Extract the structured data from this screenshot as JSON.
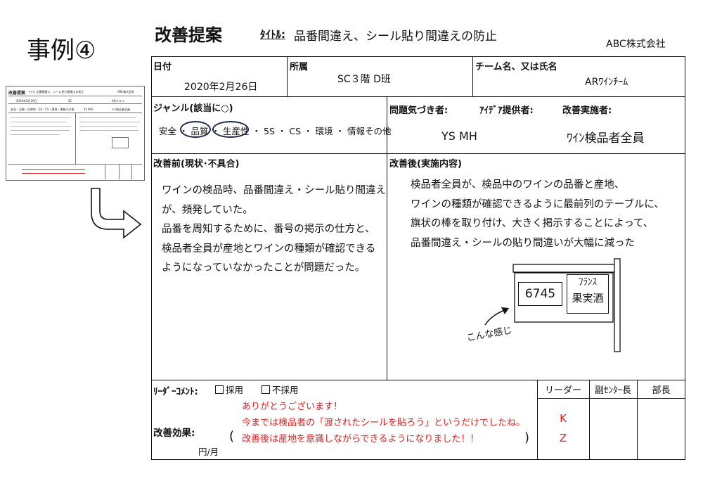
{
  "case_label": "事例④",
  "doc": {
    "title": "改善提案",
    "subtitle_label": "ﾀｲﾄﾙ:",
    "subtitle_value": "品番間違え、シール貼り間違えの防止",
    "company": "ABC株式会社"
  },
  "row1": {
    "date_label": "日付",
    "date_value": "2020年2月26日",
    "dept_label": "所属",
    "dept_value": "SC３階 D班",
    "team_label": "チーム名、又は氏名",
    "team_value": "ARﾜｲﾝﾁｰﾑ"
  },
  "genre": {
    "label": "ジャンル(該当に○)",
    "items": [
      "安全",
      "品質",
      "生産性",
      "5S",
      "CS",
      "環境",
      "情報その他"
    ],
    "separator": "・"
  },
  "people": {
    "noticer_label": "問題気づき者:",
    "idea_label": "ｱｲﾃﾞｱ提供者:",
    "implementer_label": "改善実施者:",
    "noticer_idea_value": "YS MH",
    "implementer_value": "ﾜｲﾝ検品者全員"
  },
  "before": {
    "label": "改善前(現状･不具合)",
    "lines": [
      "ワインの検品時、品番間違え・シール貼り間違え",
      "が、頻発していた。",
      "品番を周知するために、番号の掲示の仕方と、",
      "検品者全員が産地とワインの種類が確認できる",
      "ようになっていなかったことが問題だった。"
    ]
  },
  "after": {
    "label": "改善後(実施内容)",
    "lines": [
      "検品者全員が、検品中のワインの品番と産地、",
      "ワインの種類が確認できるように最前列のテーブルに、",
      "旗状の棒を取り付け、大きく掲示することによって、",
      "品番間違え・シールの貼り間違いが大幅に減った"
    ],
    "sign_number": "6745",
    "sign_line1": "ﾌﾗﾝｽ",
    "sign_line2": "果実酒",
    "sketch_note": "こんな感じ"
  },
  "bottom": {
    "leader_comment_label": "ﾘｰﾀﾞｰｺﾒﾝﾄ:",
    "adopt_label": "採用",
    "reject_label": "不採用",
    "effect_label": "改善効果:",
    "per_month": "円/月",
    "paren_open": "(",
    "paren_close": ")",
    "comment_lines": [
      "ありがとうございます！",
      "今までは検品者の「渡されたシールを貼ろう」というだけでしたね。",
      "改善後は産地を意識しながらできるようになりました！！"
    ],
    "approvers": [
      "リーダー",
      "副ｾﾝﾀｰ長",
      "部長"
    ],
    "leader_stamp_1": "K",
    "leader_stamp_2": "Z"
  },
  "thumbnail": {
    "title": "改善提案",
    "subtitle": "ﾀｲﾄﾙ: 品番間違え、シール貼り間違えの防止",
    "company": "ABC株式会社",
    "date": "2020年2月26日",
    "dept": "SC",
    "team": "ARﾜｲﾝﾁｰﾑ",
    "genre": "安全・品質・生産性・5S・CS・環境・情報その他",
    "people": "YS MH",
    "implementer": "ﾜｲﾝ検品者全員"
  },
  "colors": {
    "accent_red": "#e02020",
    "circle_navy": "#1b2a4a",
    "border": "#111111"
  }
}
